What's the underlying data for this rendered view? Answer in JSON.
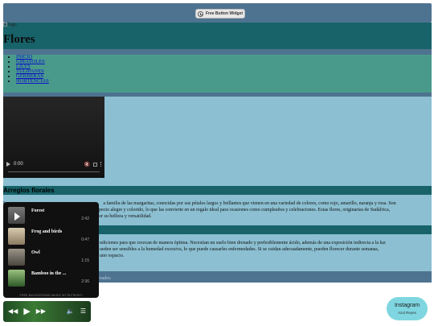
{
  "widget_bar": {
    "button_label": "Free Button Widget",
    "icon": "clock-arrow-icon"
  },
  "header": {
    "logo_alt": "logo",
    "title": "Flores"
  },
  "nav": {
    "items": [
      "INICIO",
      "GIRASOLES",
      "LILYS",
      "TULIPANES",
      "GERBERAS",
      "HORTENCIAS"
    ]
  },
  "video": {
    "time": "0:00",
    "icons": [
      "play-icon",
      "volume-muted-icon",
      "fullscreen-icon",
      "more-options-icon"
    ]
  },
  "arreglos": {
    "title": "Arreglos florales",
    "text_start": "La",
    "text_mid": "a familia de las margaritas, conocidas por sus pétalos largos y brillantes que vienen en una variedad de colores, como rojo, amarillo, naranja y rosa. Son",
    "text_mid2": "pecto alegre y colorido, lo que las convierte en un regalo ideal para ocasiones como cumpleaños y celebraciones. Estas flores, originarias de Sudáfrica,",
    "text_end": "or su belleza y versatilidad."
  },
  "cuidados": {
    "line1": "ndiciones para que crezcan de manera óptima. Necesitan un suelo bien drenado y preferiblemente ácido, además de una exposición indirecta a la luz",
    "line2": "ueden ser sensibles a la humedad excesiva, lo que puede causarles enfermedades. Si se cuidan adecuadamente, pueden florecer durante semanas,",
    "line3": "uier espacio."
  },
  "footer": {
    "text": "reados"
  },
  "playlist": {
    "tracks": [
      {
        "title": "Forest",
        "duration": "2:42",
        "thumb": "#8a8a8a"
      },
      {
        "title": "Frog and birds",
        "duration": "0:47",
        "thumb": "#b9a98c"
      },
      {
        "title": "Owl",
        "duration": "1:15",
        "thumb": "#6f6a60"
      },
      {
        "title": "Bamboo in the ...",
        "duration": "2:36",
        "thumb": "#5b8a4e"
      }
    ],
    "credit": "FREE BACKGROUND MUSIC BY ELFSIGHT"
  },
  "player": {
    "controls": [
      "rewind-icon",
      "play-icon",
      "fast-forward-icon",
      "volume-icon",
      "playlist-icon"
    ]
  },
  "instagram": {
    "label": "Instagram",
    "name": "Azul Reyes",
    "color": "#7fd6e0"
  }
}
